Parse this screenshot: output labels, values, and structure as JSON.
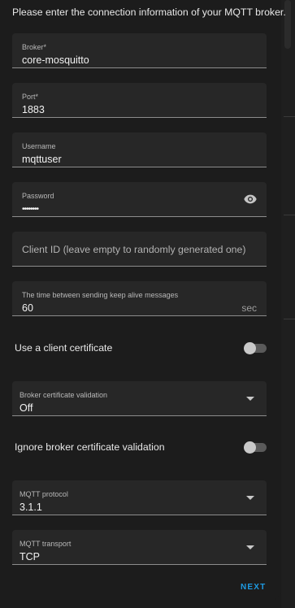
{
  "intro": "Please enter the connection information of your MQTT broker.",
  "fields": {
    "broker": {
      "label": "Broker*",
      "value": "core-mosquitto"
    },
    "port": {
      "label": "Port*",
      "value": "1883"
    },
    "username": {
      "label": "Username",
      "value": "mqttuser"
    },
    "password": {
      "label": "Password",
      "value": "••••••••",
      "icon": "eye-icon"
    },
    "client_id": {
      "placeholder": "Client ID (leave empty to randomly generated one)"
    },
    "keepalive": {
      "label": "The time between sending keep alive messages",
      "value": "60",
      "suffix": "sec"
    },
    "broker_cert_validation": {
      "label": "Broker certificate validation",
      "value": "Off"
    },
    "mqtt_protocol": {
      "label": "MQTT protocol",
      "value": "3.1.1"
    },
    "mqtt_transport": {
      "label": "MQTT transport",
      "value": "TCP"
    }
  },
  "toggles": {
    "client_certificate": {
      "label": "Use a client certificate",
      "on": false
    },
    "ignore_validation": {
      "label": "Ignore broker certificate validation",
      "on": false
    }
  },
  "actions": {
    "next": "NEXT"
  },
  "colors": {
    "accent": "#1e9be3",
    "background": "#1c1c1c",
    "field": "#272727"
  }
}
